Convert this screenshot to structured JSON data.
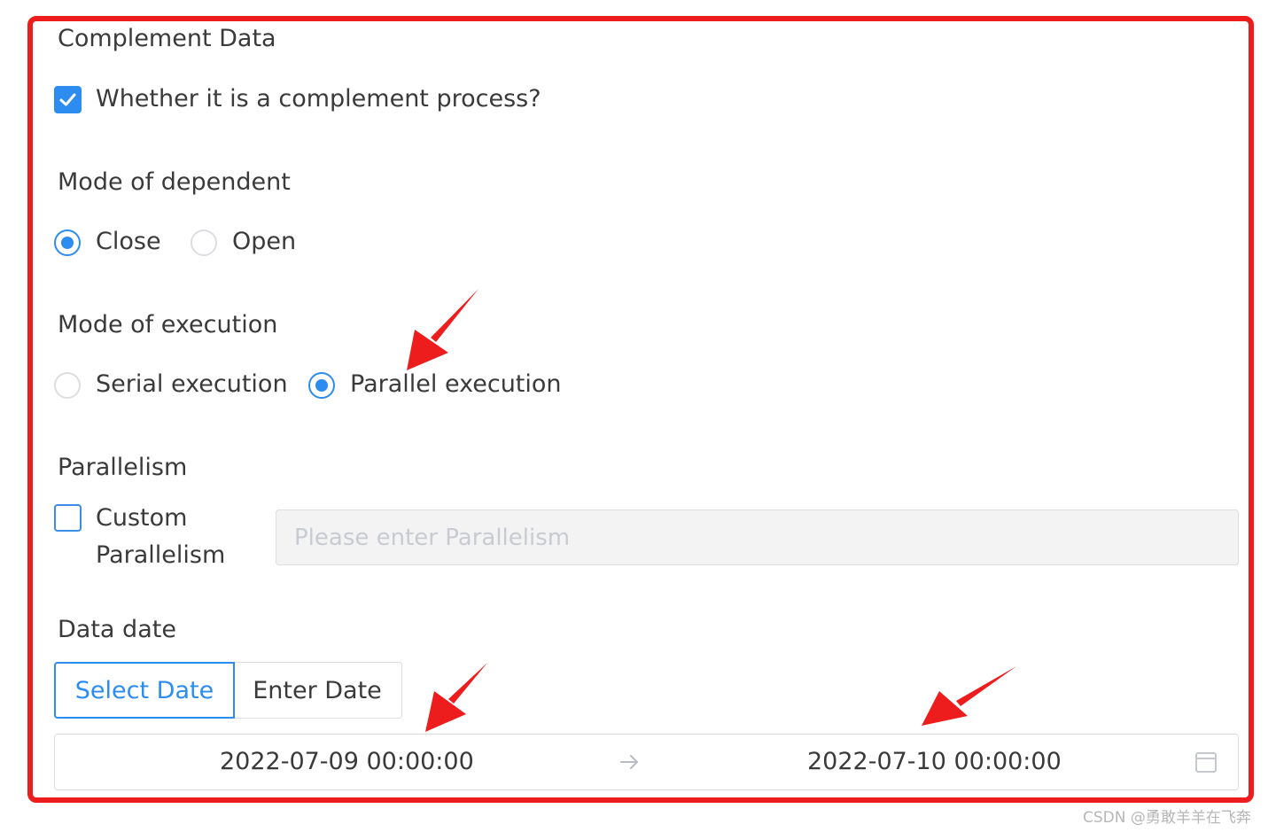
{
  "section_title": "Complement Data",
  "complement": {
    "label": "Whether it is a complement process?",
    "checked": true
  },
  "dependent_mode": {
    "label": "Mode of dependent",
    "options": [
      {
        "label": "Close",
        "selected": true
      },
      {
        "label": "Open",
        "selected": false
      }
    ]
  },
  "execution_mode": {
    "label": "Mode of execution",
    "options": [
      {
        "label": "Serial execution",
        "selected": false
      },
      {
        "label": "Parallel execution",
        "selected": true
      }
    ]
  },
  "parallelism": {
    "label": "Parallelism",
    "custom_label_line1": "Custom",
    "custom_label_line2": "Parallelism",
    "custom_checked": false,
    "input_placeholder": "Please enter Parallelism",
    "input_value": ""
  },
  "data_date": {
    "label": "Data date",
    "tabs": [
      {
        "label": "Select Date",
        "active": true
      },
      {
        "label": "Enter Date",
        "active": false
      }
    ],
    "start": "2022-07-09 00:00:00",
    "end": "2022-07-10 00:00:00",
    "separator_icon": "arrow-right-icon",
    "calendar_icon": "calendar-icon"
  },
  "colors": {
    "primary": "#2d8cf0",
    "annotation": "#ee1d1d",
    "border": "#dcdee2"
  },
  "watermark": "CSDN @勇敢羊羊在飞奔"
}
